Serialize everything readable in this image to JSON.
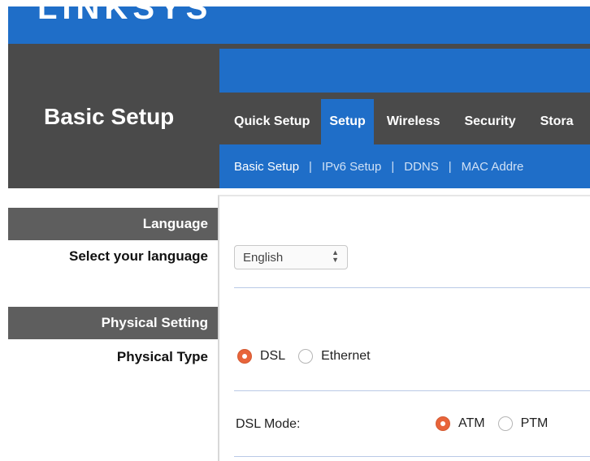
{
  "brand": {
    "logo_text": "LINKSYS"
  },
  "page_title": "Basic Setup",
  "tabs": [
    {
      "label": "Quick Setup",
      "active": false
    },
    {
      "label": "Setup",
      "active": true
    },
    {
      "label": "Wireless",
      "active": false
    },
    {
      "label": "Security",
      "active": false
    },
    {
      "label": "Stora",
      "active": false
    }
  ],
  "subtabs": [
    {
      "label": "Basic Setup",
      "active": true
    },
    {
      "label": "IPv6 Setup",
      "active": false
    },
    {
      "label": "DDNS",
      "active": false
    },
    {
      "label": "MAC Addre",
      "active": false
    }
  ],
  "sections": {
    "language": {
      "heading": "Language",
      "row_label": "Select your language",
      "select_value": "English"
    },
    "physical": {
      "heading": "Physical Setting",
      "row_label": "Physical Type",
      "options": [
        {
          "label": "DSL",
          "checked": true
        },
        {
          "label": "Ethernet",
          "checked": false
        }
      ],
      "dsl_mode_label": "DSL Mode:",
      "dsl_mode_options": [
        {
          "label": "ATM",
          "checked": true
        },
        {
          "label": "PTM",
          "checked": false
        }
      ]
    }
  },
  "colors": {
    "accent_blue": "#1f6ec8",
    "header_gray": "#4a4a4a",
    "section_gray": "#5e5e5e",
    "radio_orange": "#e8643a"
  }
}
